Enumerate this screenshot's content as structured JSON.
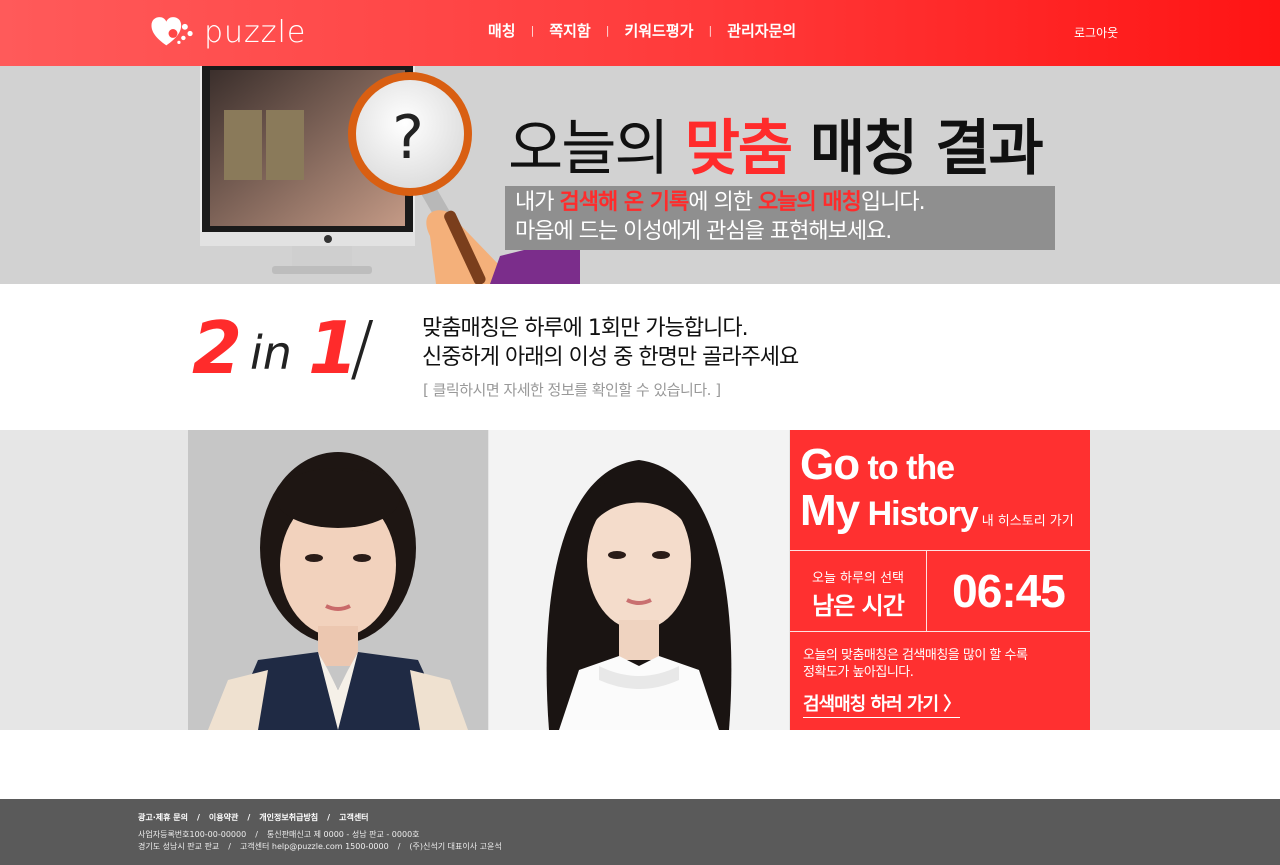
{
  "header": {
    "logo_text": "puzzle",
    "nav": [
      "매칭",
      "쪽지함",
      "키워드평가",
      "관리자문의"
    ],
    "logout": "로그아웃"
  },
  "banner": {
    "title_part1": "오늘의 ",
    "title_part2": "맞춤",
    "title_part3": " 매칭 결과",
    "line1_a": "내가 ",
    "line1_b": "검색해 온 기록",
    "line1_c": "에 의한 ",
    "line1_d": "오늘의 매칭",
    "line1_e": "입니다.",
    "line2": "마음에 드는 이성에게 관심을 표현해보세요.",
    "question_mark": "?"
  },
  "rule": {
    "num_a": "2",
    "word_in": "in",
    "num_b": "1",
    "slash": "/",
    "line1": "맞춤매칭은 하루에 1회만 가능합니다.",
    "line2": "신중하게 아래의 이성 중 한명만 골라주세요",
    "sub": "[ 클릭하시면 자세한 정보를 확인할 수 있습니다. ]"
  },
  "panel": {
    "go": "Go",
    "to_the": " to the",
    "my": "My",
    "history": " History",
    "history_kor": "내 히스토리 가기",
    "remain_small": "오늘 하루의 선택",
    "remain_big": "남은 시간",
    "timer": "06:45",
    "notice1": "오늘의 맞춤매칭은 검색매칭을 많이 할 수록",
    "notice2": "정확도가 높아집니다.",
    "search_link": "검색매칭 하러 가기 〉"
  },
  "footer": {
    "links": [
      "광고·제휴 문의",
      "이용약관",
      "개인정보취급방침",
      "고객센터"
    ],
    "info1_a": "사업자등록번호100-00-00000",
    "info1_b": "통신판매신고 제 0000 - 성남 판교 - 0000호",
    "info2_a": "경기도 성남시 판교 판교",
    "info2_b": "고객센터 help@puzzle.com 1500-0000",
    "info2_c": "(주)신석기 대표이사 고윤석"
  },
  "colors": {
    "accent": "#ff3030",
    "banner_bg": "#d2d2d2",
    "footer_bg": "#5a5a5a"
  }
}
